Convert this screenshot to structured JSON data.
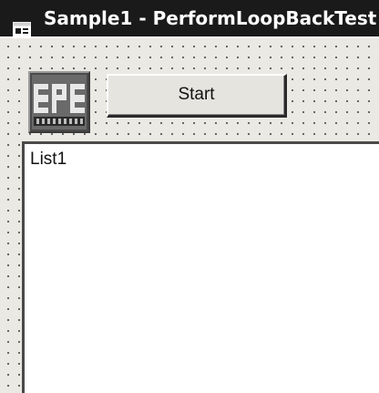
{
  "window": {
    "title": "Sample1 - PerformLoopBackTest",
    "icon": "form-icon"
  },
  "form": {
    "logo": {
      "icon": "epe-logo",
      "lettering": "EPE"
    },
    "start_button": {
      "label": "Start"
    },
    "list": {
      "label": "List1"
    }
  },
  "colors": {
    "titlebar": "#1a1a1a",
    "form_background": "#ebe9e3",
    "grid_dots": "#5a5a5a",
    "list_background": "#ffffff"
  }
}
